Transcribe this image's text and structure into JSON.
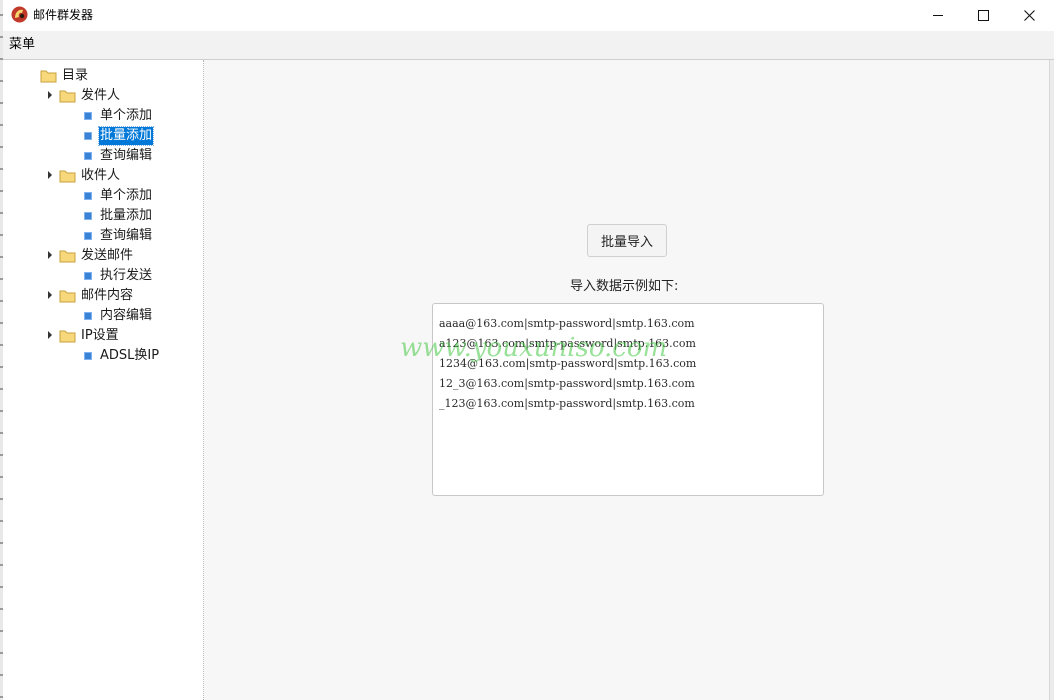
{
  "window": {
    "title": "邮件群发器",
    "accent": "#0078d7"
  },
  "menubar": {
    "menu_label": "菜单"
  },
  "tree": {
    "root": "目录",
    "groups": [
      {
        "label": "发件人",
        "items": [
          "单个添加",
          "批量添加",
          "查询编辑"
        ]
      },
      {
        "label": "收件人",
        "items": [
          "单个添加",
          "批量添加",
          "查询编辑"
        ]
      },
      {
        "label": "发送邮件",
        "items": [
          "执行发送"
        ]
      },
      {
        "label": "邮件内容",
        "items": [
          "内容编辑"
        ]
      },
      {
        "label": "IP设置",
        "items": [
          "ADSL换IP"
        ]
      }
    ],
    "selected": "发件人 / 批量添加"
  },
  "main": {
    "import_button": "批量导入",
    "example_label": "导入数据示例如下:",
    "example_lines": [
      "aaaa@163.com|smtp-password|smtp.163.com",
      "a123@163.com|smtp-password|smtp.163.com",
      "1234@163.com|smtp-password|smtp.163.com",
      "12_3@163.com|smtp-password|smtp.163.com",
      "_123@163.com|smtp-password|smtp.163.com"
    ]
  },
  "watermark": "www.youxuniso.com"
}
